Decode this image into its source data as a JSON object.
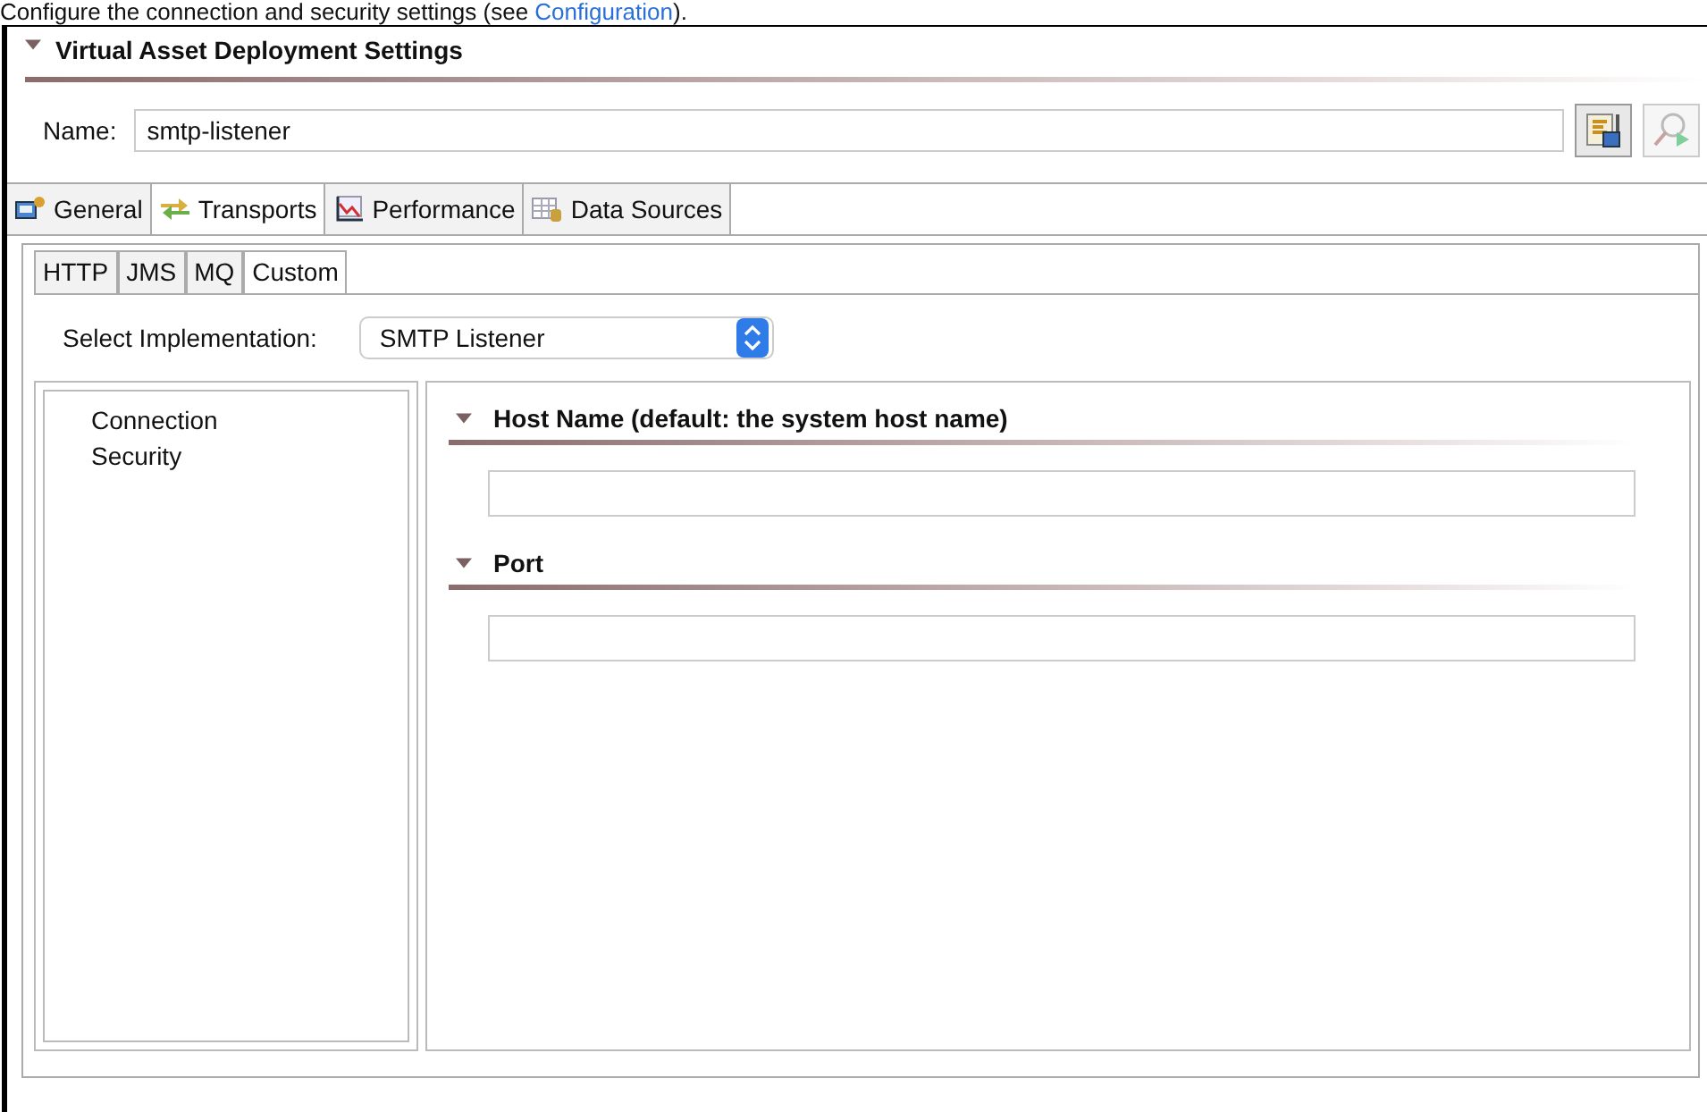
{
  "intro": {
    "text": "Configure the connection and security settings (see ",
    "link": "Configuration",
    "after": ")."
  },
  "section": {
    "title": "Virtual Asset Deployment Settings",
    "expanded": true
  },
  "name": {
    "label": "Name:",
    "value": "smtp-listener"
  },
  "tabs": [
    {
      "label": "General",
      "selected": false
    },
    {
      "label": "Transports",
      "selected": true
    },
    {
      "label": "Performance",
      "selected": false
    },
    {
      "label": "Data Sources",
      "selected": false
    }
  ],
  "subtabs": [
    {
      "label": "HTTP",
      "selected": false
    },
    {
      "label": "JMS",
      "selected": false
    },
    {
      "label": "MQ",
      "selected": false
    },
    {
      "label": "Custom",
      "selected": true
    }
  ],
  "implementation": {
    "label": "Select Implementation:",
    "value": "SMTP Listener"
  },
  "nav": [
    "Connection",
    "Security"
  ],
  "sections": [
    {
      "title": "Host Name (default: the system host name)",
      "expanded": true
    },
    {
      "title": "Port",
      "expanded": true
    }
  ]
}
